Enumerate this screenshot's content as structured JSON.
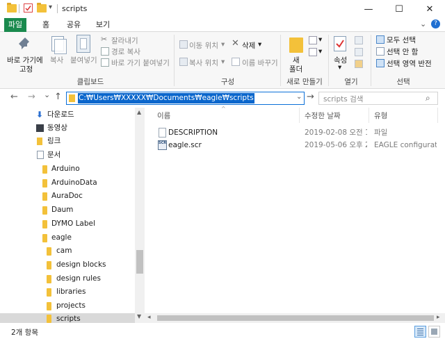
{
  "window": {
    "title": "scripts",
    "min": "—",
    "max": "☐",
    "close": "✕"
  },
  "tabs": {
    "file": "파일",
    "home": "홈",
    "share": "공유",
    "view": "보기",
    "chevron": "⌄",
    "help": "?"
  },
  "ribbon": {
    "clipboard": {
      "pin": "바로 가기에",
      "pin2": "고정",
      "copy": "복사",
      "paste": "붙여넣기",
      "cut": "잘라내기",
      "copy_path": "경로 복사",
      "paste_shortcut": "바로 가기 붙여넣기",
      "label": "클립보드"
    },
    "organize": {
      "move_to": "이동 위치",
      "copy_to": "복사 위치",
      "delete": "삭제",
      "rename": "이름 바꾸기",
      "label": "구성"
    },
    "new": {
      "new_folder_1": "새",
      "new_folder_2": "폴더",
      "label": "새로 만들기"
    },
    "open": {
      "properties": "속성",
      "label": "열기"
    },
    "select": {
      "select_all": "모두 선택",
      "select_none": "선택 안 함",
      "invert": "선택 영역 반전",
      "label": "선택"
    }
  },
  "address": {
    "path": "C:₩Users₩XXXXX₩Documents₩eagle₩scripts",
    "search_placeholder": "scripts 검색",
    "back": "←",
    "forward": "→",
    "recent": "⌄",
    "up": "↑",
    "dropdown": "⌄",
    "go": "→",
    "search_icon": "⌕"
  },
  "nav": {
    "items": [
      {
        "label": "다운로드"
      },
      {
        "label": "동영상"
      },
      {
        "label": "링크"
      },
      {
        "label": "문서"
      },
      {
        "label": "Arduino"
      },
      {
        "label": "ArduinoData"
      },
      {
        "label": "AuraDoc"
      },
      {
        "label": "Daum"
      },
      {
        "label": "DYMO Label"
      },
      {
        "label": "eagle"
      },
      {
        "label": "cam"
      },
      {
        "label": "design blocks"
      },
      {
        "label": "design rules"
      },
      {
        "label": "libraries"
      },
      {
        "label": "projects"
      },
      {
        "label": "scripts"
      }
    ]
  },
  "content": {
    "columns": {
      "name": "이름",
      "date": "수정한 날짜",
      "type": "유형",
      "sort_indicator": "^"
    },
    "files": [
      {
        "name": "DESCRIPTION",
        "date": "2019-02-08 오전 1...",
        "type": "파일",
        "icon": "file-icon"
      },
      {
        "name": "eagle.scr",
        "date": "2019-05-06 오후 2...",
        "type": "EAGLE configurati...",
        "icon": "scr-file-icon"
      }
    ]
  },
  "status": {
    "count": "2개 항목"
  },
  "colors": {
    "accent": "#0a66cc",
    "file_tab": "#1a8a4e",
    "folder": "#f3c13a"
  }
}
